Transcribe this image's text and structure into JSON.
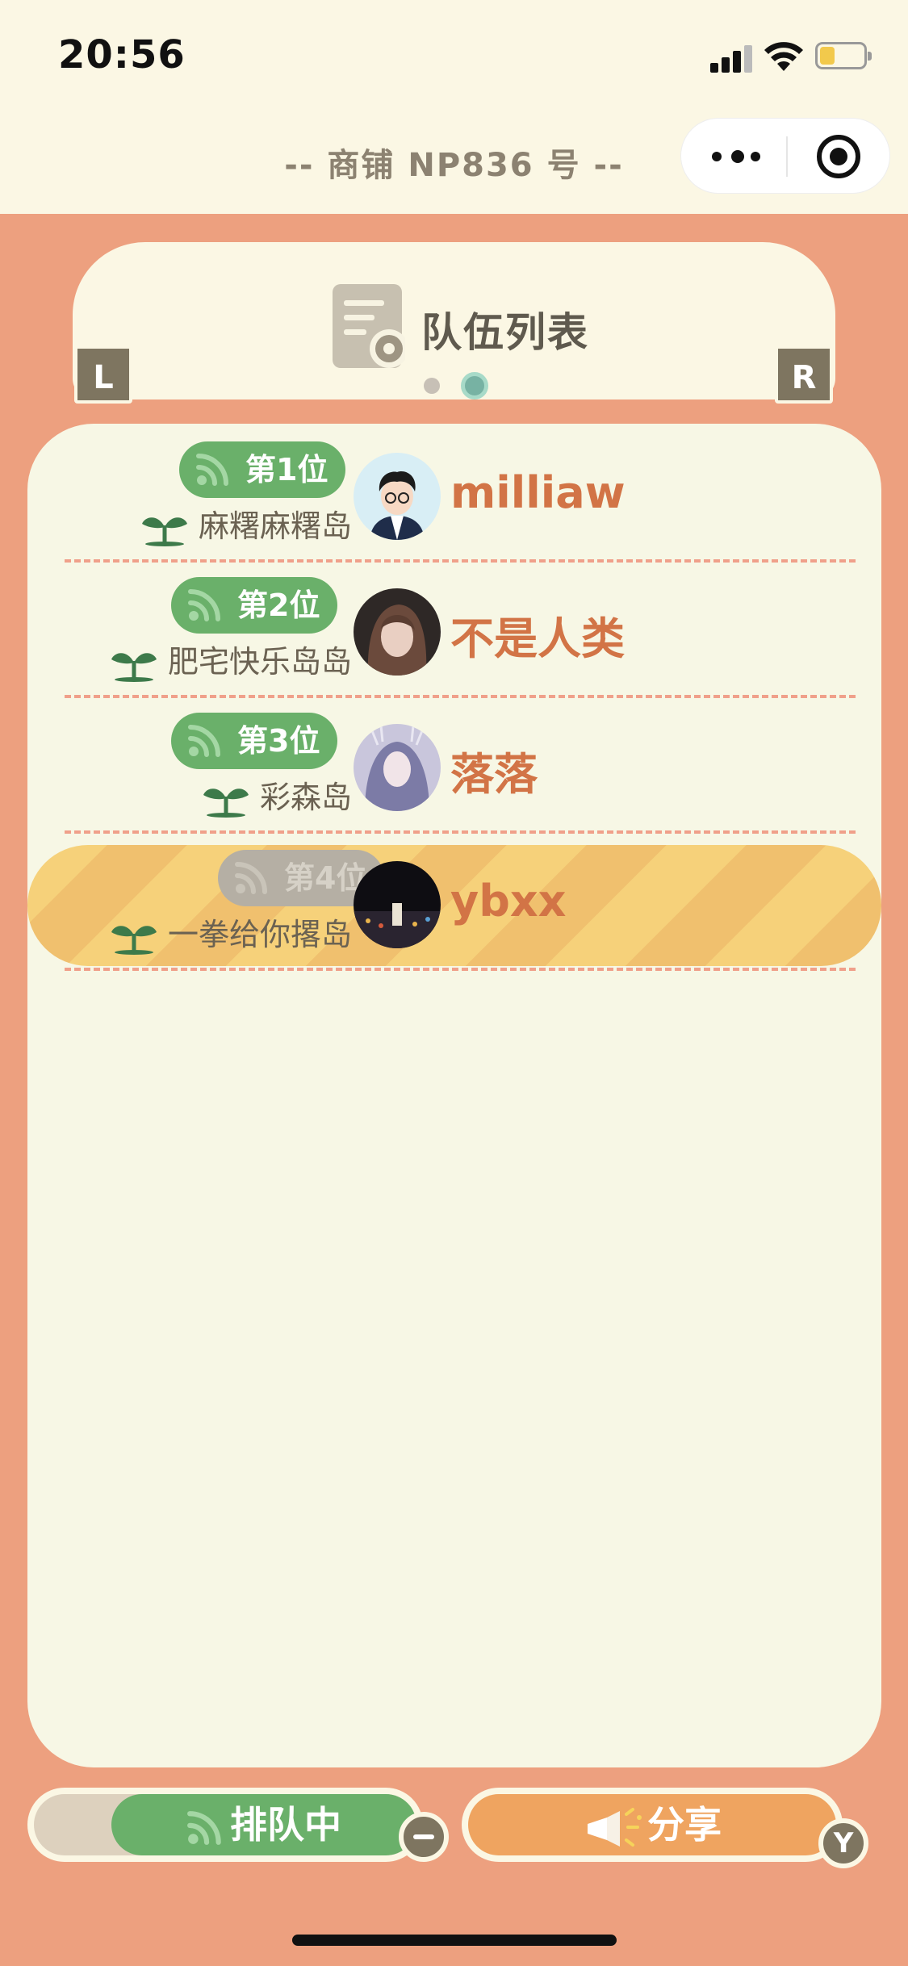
{
  "status_bar": {
    "time": "20:56"
  },
  "nav": {
    "title": "-- 商铺 NP836 号 --"
  },
  "header": {
    "title": "队伍列表",
    "left_shoulder": "L",
    "right_shoulder": "R",
    "page_count": 2,
    "active_page": 2
  },
  "queue": [
    {
      "rank": "第1位",
      "island": "麻糬麻糬岛",
      "name": "milliaw",
      "active": true
    },
    {
      "rank": "第2位",
      "island": "肥宅快乐岛岛",
      "name": "不是人类",
      "active": true
    },
    {
      "rank": "第3位",
      "island": "彩森岛",
      "name": "落落",
      "active": true
    },
    {
      "rank": "第4位",
      "island": "一拳给你撂岛",
      "name": "ybxx",
      "active": false,
      "highlighted": true
    }
  ],
  "bottom": {
    "queue_label": "排队中",
    "share_label": "分享",
    "y_button": "Y"
  },
  "colors": {
    "background": "#EDA07F",
    "panel": "#F7F7E5",
    "green": "#6AB06A",
    "name": "#D27446",
    "share": "#EFA460"
  }
}
